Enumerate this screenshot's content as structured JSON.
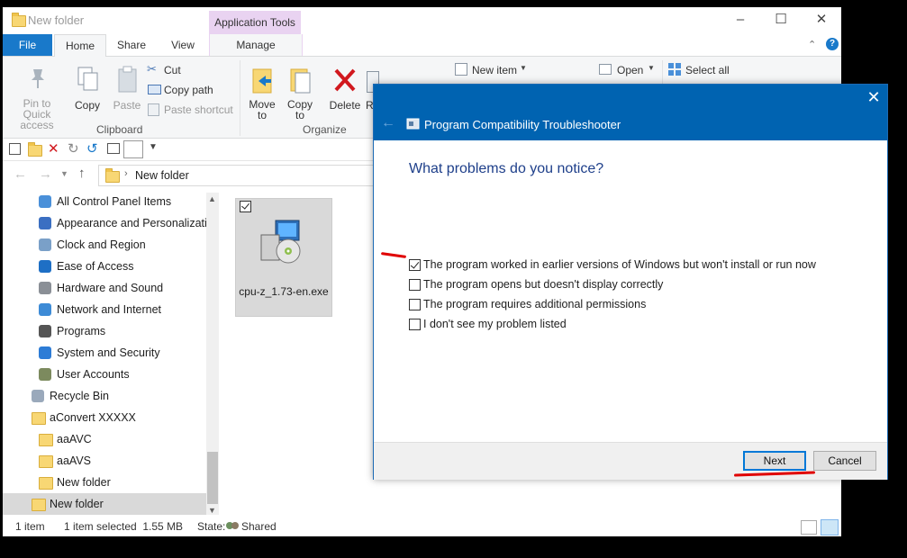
{
  "explorer": {
    "title": "New folder",
    "context_tab": "Application Tools",
    "tabs": {
      "file": "File",
      "home": "Home",
      "share": "Share",
      "view": "View",
      "manage": "Manage"
    },
    "ribbon": {
      "pin_label": "Pin to Quick access",
      "copy_label": "Copy",
      "paste_label": "Paste",
      "cut_label": "Cut",
      "copy_path_label": "Copy path",
      "paste_shortcut_label": "Paste shortcut",
      "clipboard_group": "Clipboard",
      "move_to_label": "Move to",
      "copy_to_label": "Copy to",
      "delete_label": "Delete",
      "rename_label": "R",
      "organize_group": "Organize",
      "new_item_label": "New item",
      "open_label": "Open",
      "select_all_label": "Select all"
    },
    "address": {
      "path": "New folder"
    },
    "nav_items": [
      {
        "label": "All Control Panel Items",
        "icon": "control-panel-icon"
      },
      {
        "label": "Appearance and Personalization",
        "icon": "appearance-icon"
      },
      {
        "label": "Clock and Region",
        "icon": "clock-icon"
      },
      {
        "label": "Ease of Access",
        "icon": "ease-of-access-icon"
      },
      {
        "label": "Hardware and Sound",
        "icon": "hardware-icon"
      },
      {
        "label": "Network and Internet",
        "icon": "network-icon"
      },
      {
        "label": "Programs",
        "icon": "programs-icon"
      },
      {
        "label": "System and Security",
        "icon": "shield-icon"
      },
      {
        "label": "User Accounts",
        "icon": "users-icon"
      },
      {
        "label": "Recycle Bin",
        "icon": "recycle-bin-icon"
      },
      {
        "label": "aConvert XXXXX",
        "icon": "folder-icon"
      },
      {
        "label": "aaAVC",
        "icon": "folder-icon"
      },
      {
        "label": "aaAVS",
        "icon": "folder-icon"
      },
      {
        "label": "New folder",
        "icon": "folder-icon"
      },
      {
        "label": "New folder",
        "icon": "folder-icon"
      }
    ],
    "file": {
      "name": "cpu-z_1.73-en.exe"
    },
    "status": {
      "count": "1 item",
      "selected": "1 item selected  1.55 MB",
      "state_label": "State:",
      "state_value": "Shared"
    }
  },
  "dialog": {
    "title": "Program Compatibility Troubleshooter",
    "question": "What problems do you notice?",
    "options": [
      {
        "label": "The program worked in earlier versions of Windows but won't install or run now",
        "checked": true
      },
      {
        "label": "The program opens but doesn't display correctly",
        "checked": false
      },
      {
        "label": "The program requires additional permissions",
        "checked": false
      },
      {
        "label": "I don't see my problem listed",
        "checked": false
      }
    ],
    "next_label": "Next",
    "cancel_label": "Cancel"
  },
  "colors": {
    "accent": "#0063b1",
    "file_tab": "#1979ca",
    "context_tab": "#e9d3f1",
    "annotation": "#e00000"
  }
}
